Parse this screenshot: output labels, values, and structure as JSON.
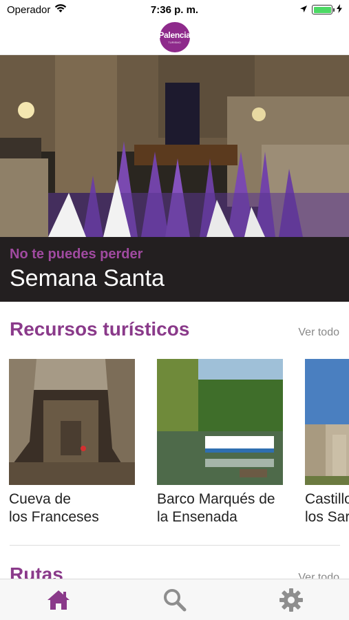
{
  "status_bar": {
    "carrier": "Operador",
    "time": "7:36 p. m."
  },
  "header": {
    "logo_text": "Palencia",
    "logo_subtext": "TURISMO"
  },
  "hero": {
    "kicker": "No te puedes perder",
    "title": "Semana Santa"
  },
  "sections": {
    "recursos": {
      "title": "Recursos turísticos",
      "see_all": "Ver todo",
      "cards": [
        {
          "title": "Cueva de\nlos Franceses"
        },
        {
          "title": "Barco Marqués de\nla Ensenada"
        },
        {
          "title": "Castillo de\nlos Sarmiento"
        }
      ]
    },
    "rutas": {
      "title": "Rutas",
      "see_all": "Ver todo"
    }
  },
  "tab_bar": {
    "items": [
      "home-icon",
      "search-icon",
      "gear-icon"
    ],
    "active": "home-icon"
  },
  "colors": {
    "accent": "#8a3a8a",
    "hero_caption_bg": "#231f20",
    "battery": "#4cd964"
  }
}
